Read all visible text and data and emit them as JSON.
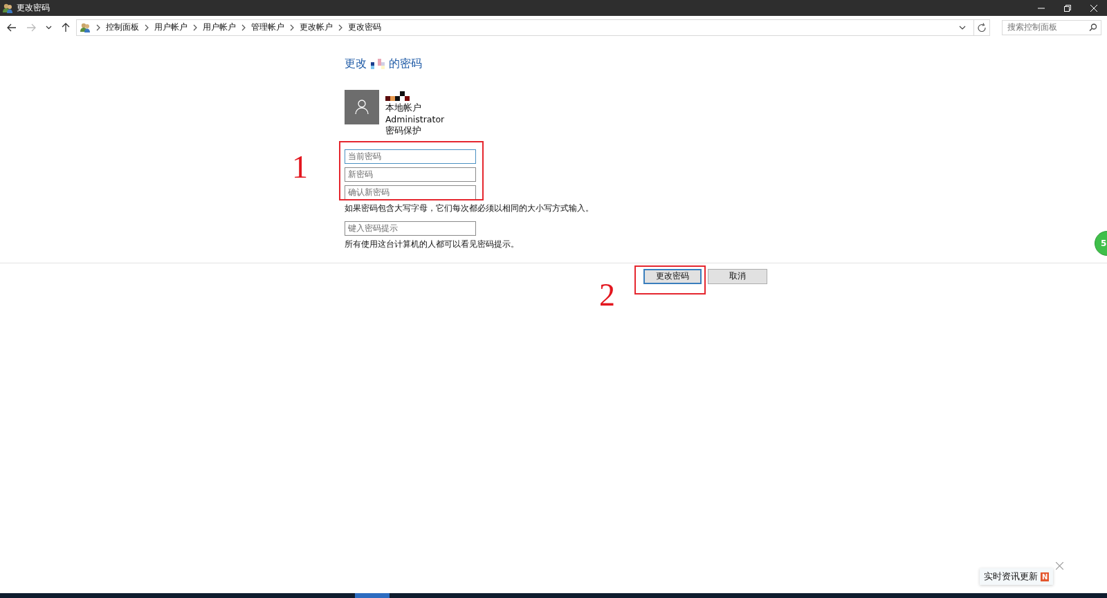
{
  "window": {
    "title": "更改密码"
  },
  "breadcrumb": [
    "控制面板",
    "用户帐户",
    "用户帐户",
    "管理帐户",
    "更改帐户",
    "更改密码"
  ],
  "search": {
    "placeholder": "搜索控制面板"
  },
  "heading": {
    "before": "更改",
    "after": "的密码"
  },
  "account": {
    "type": "本地帐户",
    "group": "Administrator",
    "protection": "密码保护"
  },
  "fields": [
    {
      "placeholder": "当前密码",
      "focused": true
    },
    {
      "placeholder": "新密码",
      "focused": false
    },
    {
      "placeholder": "确认新密码",
      "focused": false
    }
  ],
  "case_note": "如果密码包含大写字母，它们每次都必须以相同的大小写方式输入。",
  "hint_field": {
    "placeholder": "键入密码提示"
  },
  "hint_note": "所有使用这台计算机的人都可以看见密码提示。",
  "buttons": [
    {
      "label": "更改密码",
      "default": true
    },
    {
      "label": "取消",
      "default": false
    }
  ],
  "annotations": [
    "1",
    "2"
  ],
  "floating_badge": "5",
  "notification": {
    "text": "实时资讯更新",
    "badge": "N"
  }
}
